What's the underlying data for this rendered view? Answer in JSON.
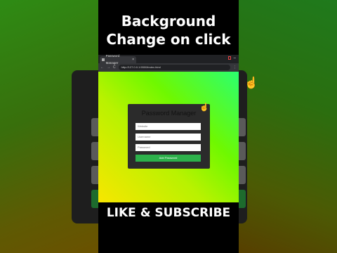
{
  "video": {
    "caption_line1": "Background",
    "caption_line2": "Change on click",
    "caption_bottom": "LIKE & SUBSCRIBE"
  },
  "browser": {
    "tab_title": "Password Manager",
    "tab_close": "×",
    "url": "http://127.0.0.1:5500/index.html",
    "nav_back": "←",
    "nav_forward": "→",
    "nav_reload": "C"
  },
  "app": {
    "title": "Password Manager",
    "website_placeholder": "Website",
    "username_placeholder": "Username",
    "password_placeholder": "Password",
    "add_button": "Add Password"
  },
  "colors": {
    "card_bg": "#2b2b2b",
    "button_green": "#2db14b",
    "gradient_yellow": "#f8e600",
    "gradient_green": "#2bff70"
  },
  "icons": [
    "pointer-cursor-icon",
    "page-favicon-icon"
  ]
}
